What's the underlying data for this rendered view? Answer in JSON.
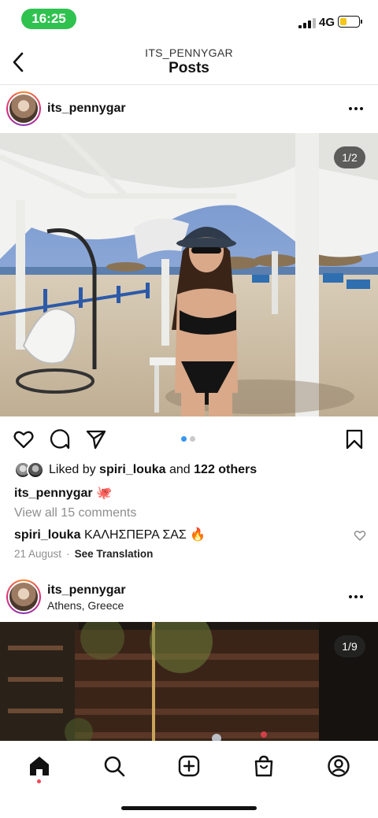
{
  "status_bar": {
    "time": "16:25",
    "network": "4G",
    "battery_level": 0.35,
    "time_pill_color": "#2fc24f",
    "battery_color": "#f5c518"
  },
  "header": {
    "subtitle": "ITS_PENNYGAR",
    "title": "Posts"
  },
  "posts": [
    {
      "username": "its_pennygar",
      "photo_counter": "1/2",
      "carousel_dots": 2,
      "active_dot": 0,
      "liked_by": {
        "prefix": "Liked by",
        "user": "spiri_louka",
        "conj": "and",
        "others": "122 others"
      },
      "caption": {
        "user": "its_pennygar",
        "text": "🐙"
      },
      "view_comments": "View all 15 comments",
      "comment": {
        "user": "spiri_louka",
        "text": "ΚΑΛΗΣΠΕΡΑ ΣΑΣ 🔥"
      },
      "date": "21 August",
      "separator": "·",
      "see_translation": "See Translation"
    },
    {
      "username": "its_pennygar",
      "location": "Athens, Greece",
      "photo_counter": "1/9"
    }
  ],
  "bottom_nav": {
    "items": [
      "home-icon",
      "search-icon",
      "new-post-icon",
      "shop-icon",
      "profile-icon"
    ],
    "active": "home-icon",
    "notification_dot_color": "#ed4956"
  },
  "colors": {
    "accent_blue": "#3897f0",
    "muted_text": "#8e8e8e"
  }
}
